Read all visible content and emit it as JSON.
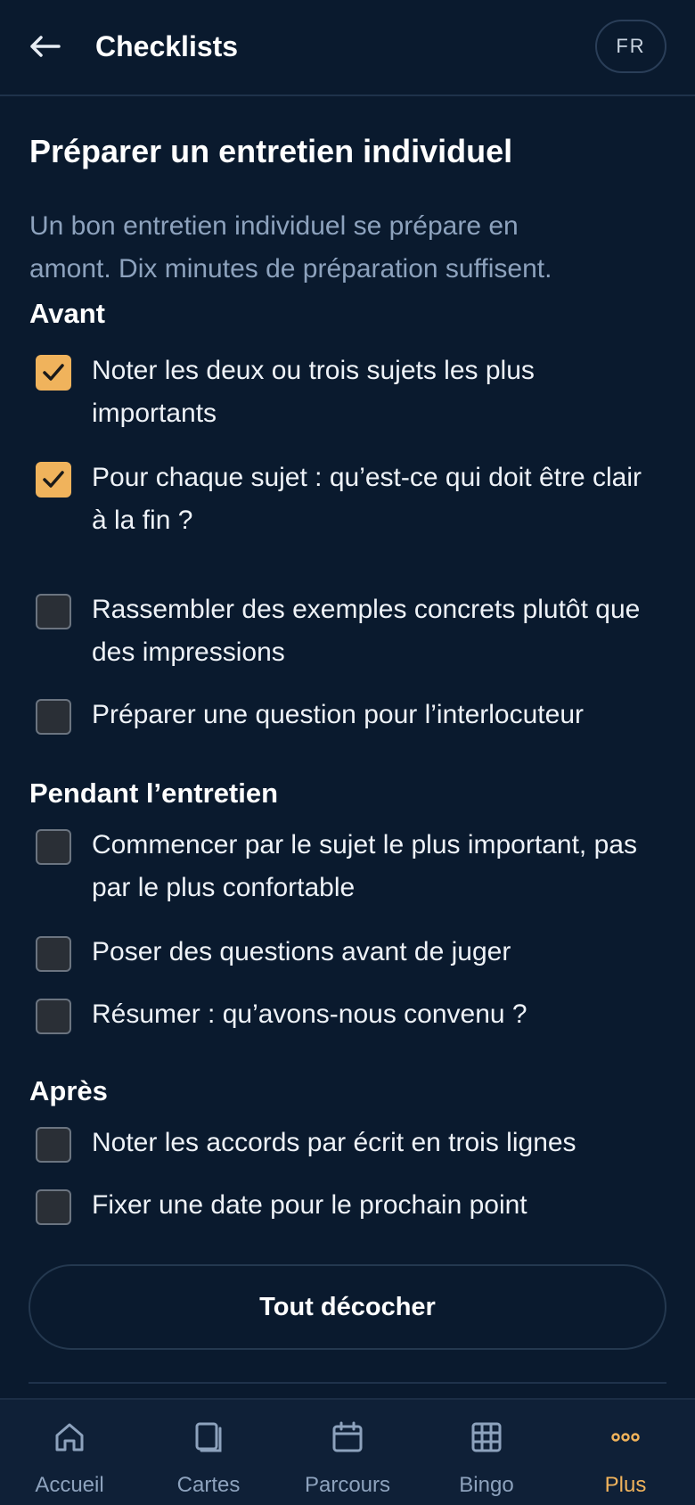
{
  "header": {
    "title": "Checklists",
    "lang": "FR"
  },
  "page": {
    "title": "Préparer un entretien individuel",
    "intro_line1": "Un bon entretien individuel se prépare en",
    "intro_line2": "amont. Dix minutes de préparation suffisent."
  },
  "sections": [
    {
      "title": "Avant",
      "items": [
        {
          "label": "Noter les deux ou trois sujets les plus importants",
          "checked": true
        },
        {
          "label": "Pour chaque sujet : qu’est-ce qui doit être clair à la fin ?",
          "checked": true
        },
        {
          "label": "Rassembler des exemples concrets plutôt que des impressions",
          "checked": false
        },
        {
          "label": "Préparer une question pour l’interlocuteur",
          "checked": false
        }
      ]
    },
    {
      "title": "Pendant l’entretien",
      "items": [
        {
          "label": "Commencer par le sujet le plus important, pas par le plus confortable",
          "checked": false
        },
        {
          "label": "Poser des questions avant de juger",
          "checked": false
        },
        {
          "label": "Résumer : qu’avons-nous convenu ?",
          "checked": false
        }
      ]
    },
    {
      "title": "Après",
      "items": [
        {
          "label": "Noter les accords par écrit en trois lignes",
          "checked": false
        },
        {
          "label": "Fixer une date pour le prochain point",
          "checked": false
        }
      ]
    }
  ],
  "actions": {
    "reset_label": "Tout décocher"
  },
  "nav": {
    "items": [
      {
        "label": "Accueil",
        "icon": "home-icon",
        "active": false
      },
      {
        "label": "Cartes",
        "icon": "cards-icon",
        "active": false
      },
      {
        "label": "Parcours",
        "icon": "calendar-icon",
        "active": false
      },
      {
        "label": "Bingo",
        "icon": "grid-icon",
        "active": false
      },
      {
        "label": "Plus",
        "icon": "more-icon",
        "active": true
      }
    ]
  },
  "colors": {
    "background": "#0a1a2e",
    "accent": "#f0b35c",
    "muted_text": "#8da2bd"
  }
}
